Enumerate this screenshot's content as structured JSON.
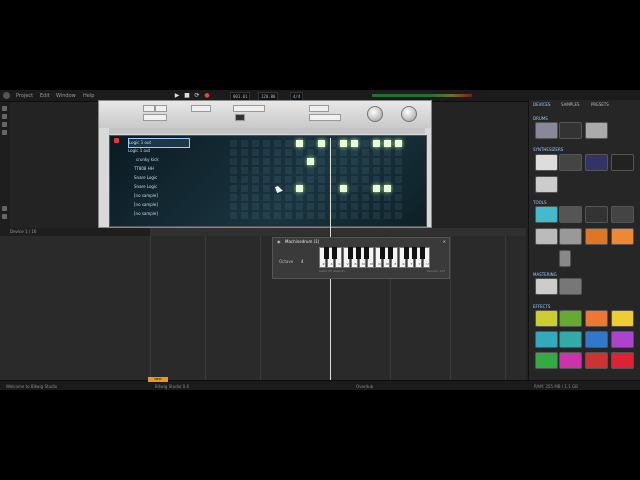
{
  "menubar": {
    "items": [
      "Project",
      "Edit",
      "Window",
      "Help"
    ]
  },
  "transport": {
    "tempo": "120.00",
    "position": "001.01",
    "signature": "4/4"
  },
  "device": {
    "row_labels": [
      "Logic 1 out",
      "Logic 1 out",
      "crunky kick",
      "TT808 HH",
      "Snare Logic",
      "Snare Logic",
      "[no sample]",
      "[no sample]",
      "[no sample]"
    ]
  },
  "right_panel": {
    "tabs": [
      "DEVICES",
      "SAMPLES",
      "PRESETS"
    ],
    "sections": [
      "DRUMS",
      "SYNTHESIZERS",
      "TOOLS",
      "MASTERING",
      "EFFECTS"
    ]
  },
  "piano": {
    "title": "Machinedrum (1)",
    "octave_label": "Octave",
    "octave_value": "4",
    "keys": [
      "Z",
      "X",
      "C",
      "V",
      "B",
      "N",
      "M",
      "Q",
      "W",
      "E",
      "R",
      "T",
      "Y",
      "U"
    ],
    "footer_left": "Latch (F) Velocity",
    "footer_right": "Velocity 127"
  },
  "sequencer": {
    "track_label": "Device 1 / 16"
  },
  "status": {
    "left": "Welcome to Bitwig Studio",
    "center": "Bitwig Studio 0.6",
    "mid": "Overdub",
    "right": "RAM: 355 MB / 1.1 GB"
  },
  "colors": {
    "accent": "#9ccfff",
    "badge": "#e89a20",
    "step_on": "#e8ffd8"
  }
}
